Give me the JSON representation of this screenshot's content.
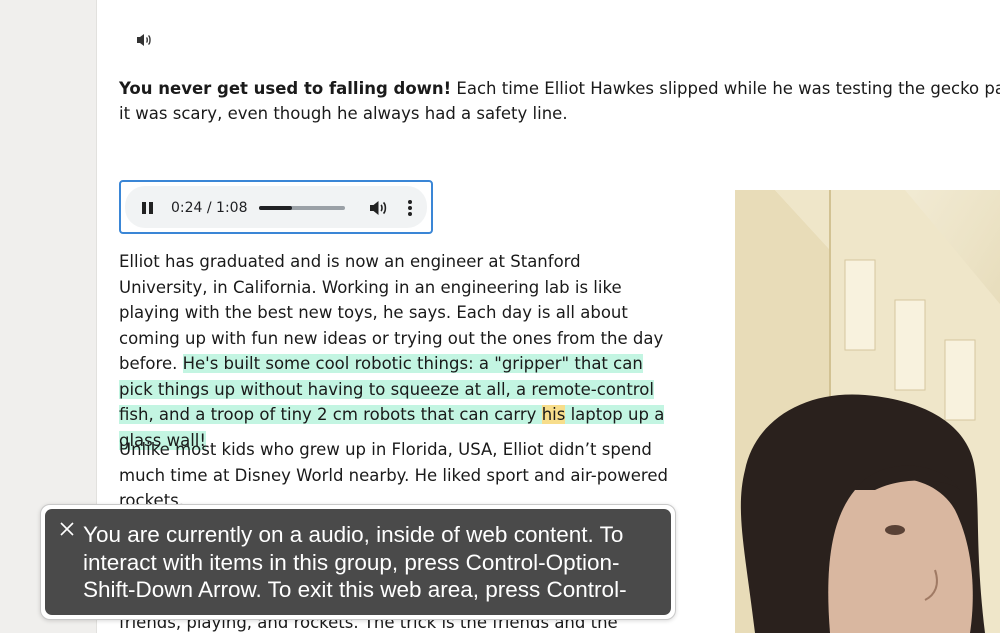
{
  "intro": {
    "bold": "You never get used to falling down!",
    "rest": " Each time Elliot Hawkes slipped while he was testing the gecko pads it was scary, even though he always had a safety line."
  },
  "audio": {
    "time": "0:24 / 1:08",
    "progress_fraction": 0.38,
    "pause_icon": "pause-icon",
    "volume_icon": "volume-icon",
    "more_icon": "more-options-icon"
  },
  "paragraph1": {
    "plain": "Elliot has graduated and is now an engineer at Stanford University, in California. Working in an engineering lab is like playing with the best new toys, he says. Each day is all about coming up with fun new ideas or trying out the ones from the day before. ",
    "highlight_before": "He's built some cool robotic things: a \"gripper\" that can pick things up without having to squeeze at all, a remote-control fish, and a troop of tiny 2 cm robots that can carry ",
    "highlight_word": "his",
    "highlight_after": " laptop up a glass wall!"
  },
  "paragraph2": "Unlike most kids who grew up in Florida, USA, Elliot didn’t spend much time at Disney World nearby. He liked sport and air-powered rockets.",
  "paragraph3": "friends, playing, and rockets. The trick is the friends and the rockets, Elliot",
  "voiceover": {
    "text": "You are currently on a audio, inside of web content. To interact with items in this group, press Control-Option-Shift-Down Arrow. To exit this web area, press Control-"
  },
  "colors": {
    "focus_ring": "#3a86d6",
    "sentence_highlight": "#c3f5e2",
    "word_highlight": "#f7dd8b",
    "voiceover_bg": "#4a4a4a"
  }
}
